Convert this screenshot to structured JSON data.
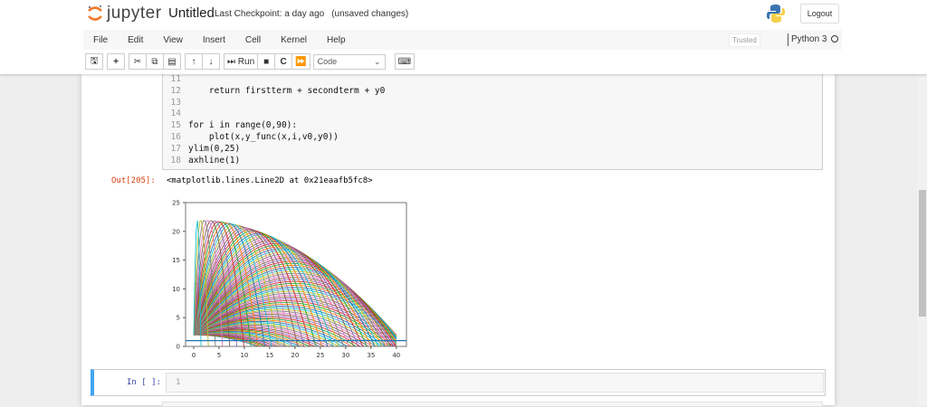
{
  "header": {
    "logo_text": "jupyter",
    "title": "Untitled",
    "checkpoint": "Last Checkpoint: a day ago",
    "unsaved": "(unsaved changes)",
    "logout": "Logout"
  },
  "menu": [
    "File",
    "Edit",
    "View",
    "Insert",
    "Cell",
    "Kernel",
    "Help"
  ],
  "status": {
    "trusted": "Trusted",
    "kernel": "Python 3"
  },
  "toolbar": {
    "run": "Run",
    "cell_type": "Code"
  },
  "cell": {
    "lines": [
      {
        "n": "11",
        "code": ""
      },
      {
        "n": "12",
        "code": "    return firstterm + secondterm + y0"
      },
      {
        "n": "13",
        "code": ""
      },
      {
        "n": "14",
        "code": ""
      },
      {
        "n": "15",
        "code": "for i in range(0,90):"
      },
      {
        "n": "16",
        "code": "    plot(x,y_func(x,i,v0,y0))"
      },
      {
        "n": "17",
        "code": "ylim(0,25)"
      },
      {
        "n": "18",
        "code": "axhline(1)"
      }
    ],
    "out_prompt": "Out[205]:",
    "output": "<matplotlib.lines.Line2D at 0x21eaafb5fc8>"
  },
  "next_cell": {
    "prompt": "In [ ]:",
    "line_number": "1"
  },
  "chart_data": {
    "type": "line",
    "title": "",
    "xlabel": "",
    "ylabel": "",
    "xlim": [
      -1.6,
      42
    ],
    "ylim": [
      0,
      25
    ],
    "xticks": [
      "0",
      "5",
      "10",
      "15",
      "20",
      "25",
      "30",
      "35",
      "40"
    ],
    "yticks": [
      "0",
      "5",
      "10",
      "15",
      "20",
      "25"
    ],
    "series_model": "projectile trajectories y = x·tan(θ) − x²/(2·R·cos²θ) + y0, θ = 0..89 degrees",
    "angles_deg_range": [
      0,
      89
    ],
    "R": 40,
    "y0": 2,
    "x_range": [
      0,
      40
    ],
    "axhline": 1,
    "colors": [
      "#1f77b4",
      "#ff7f0e",
      "#2ca02c",
      "#d62728",
      "#9467bd",
      "#8c564b",
      "#e377c2",
      "#7f7f7f",
      "#bcbd22",
      "#17becf"
    ]
  }
}
